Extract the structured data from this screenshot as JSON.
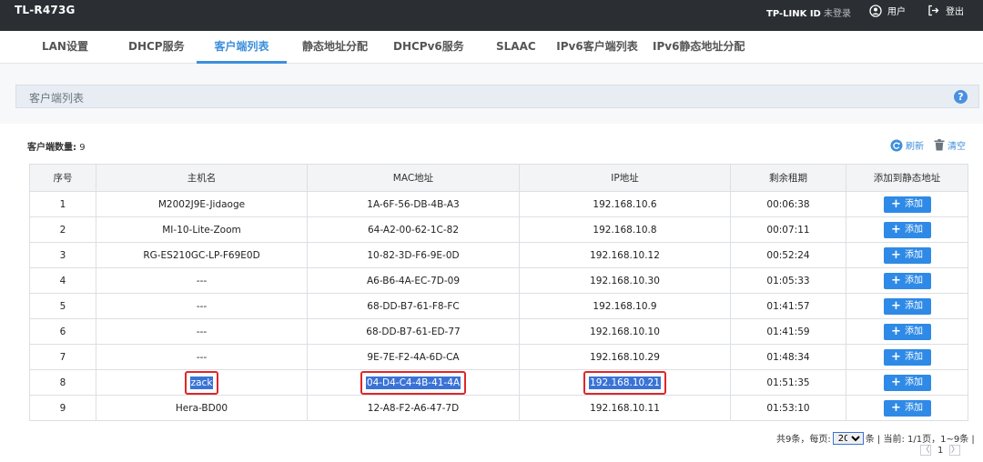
{
  "header": {
    "device": "TL-R473G",
    "tplink_id": "TP-LINK ID",
    "login_state": "未登录",
    "user_label": "用户",
    "logout_label": "登出"
  },
  "tabs": [
    {
      "label": "LAN设置"
    },
    {
      "label": "DHCP服务"
    },
    {
      "label": "客户端列表",
      "active": true
    },
    {
      "label": "静态地址分配"
    },
    {
      "label": "DHCPv6服务"
    },
    {
      "label": "SLAAC"
    },
    {
      "label": "IPv6客户端列表"
    },
    {
      "label": "IPv6静态地址分配"
    }
  ],
  "section": {
    "title": "客户端列表",
    "help": "?"
  },
  "summary": {
    "count_label": "客户端数量:",
    "count": "9"
  },
  "toolbar": {
    "refresh": "刷新",
    "clear": "清空"
  },
  "table": {
    "headers": [
      "序号",
      "主机名",
      "MAC地址",
      "IP地址",
      "剩余租期",
      "添加到静态地址"
    ],
    "add_label": "添加",
    "rows": [
      {
        "no": "1",
        "host": "M2002J9E-Jidaoge",
        "mac": "1A-6F-56-DB-4B-A3",
        "ip": "192.168.10.6",
        "lease": "00:06:38"
      },
      {
        "no": "2",
        "host": "MI-10-Lite-Zoom",
        "mac": "64-A2-00-62-1C-82",
        "ip": "192.168.10.8",
        "lease": "00:07:11"
      },
      {
        "no": "3",
        "host": "RG-ES210GC-LP-F69E0D",
        "mac": "10-82-3D-F6-9E-0D",
        "ip": "192.168.10.12",
        "lease": "00:52:24"
      },
      {
        "no": "4",
        "host": "---",
        "mac": "A6-B6-4A-EC-7D-09",
        "ip": "192.168.10.30",
        "lease": "01:05:33"
      },
      {
        "no": "5",
        "host": "---",
        "mac": "68-DD-B7-61-F8-FC",
        "ip": "192.168.10.9",
        "lease": "01:41:57"
      },
      {
        "no": "6",
        "host": "---",
        "mac": "68-DD-B7-61-ED-77",
        "ip": "192.168.10.10",
        "lease": "01:41:59"
      },
      {
        "no": "7",
        "host": "---",
        "mac": "9E-7E-F2-4A-6D-CA",
        "ip": "192.168.10.29",
        "lease": "01:48:34"
      },
      {
        "no": "8",
        "host": "zack",
        "mac": "04-D4-C4-4B-41-4A",
        "ip": "192.168.10.21",
        "lease": "01:51:35",
        "highlight": true
      },
      {
        "no": "9",
        "host": "Hera-BD00",
        "mac": "12-A8-F2-A6-47-7D",
        "ip": "192.168.10.11",
        "lease": "01:53:10"
      }
    ]
  },
  "pagination": {
    "total_text": "共9条，每页:",
    "page_size": "20",
    "page_size_options": [
      "20"
    ],
    "suffix": "条 | 当前: 1/1页，1~9条 |",
    "current_page": "1",
    "prev_glyph": "〈",
    "next_glyph": "〉"
  },
  "colors": {
    "accent": "#3d8fdc",
    "topbar": "#2b2f33",
    "highlight_box": "#e0262a",
    "selection": "#3a73d6"
  },
  "icons": {
    "user": "user-circle-icon",
    "logout": "logout-icon",
    "refresh": "refresh-icon",
    "clear": "trash-icon",
    "help": "help-icon"
  }
}
